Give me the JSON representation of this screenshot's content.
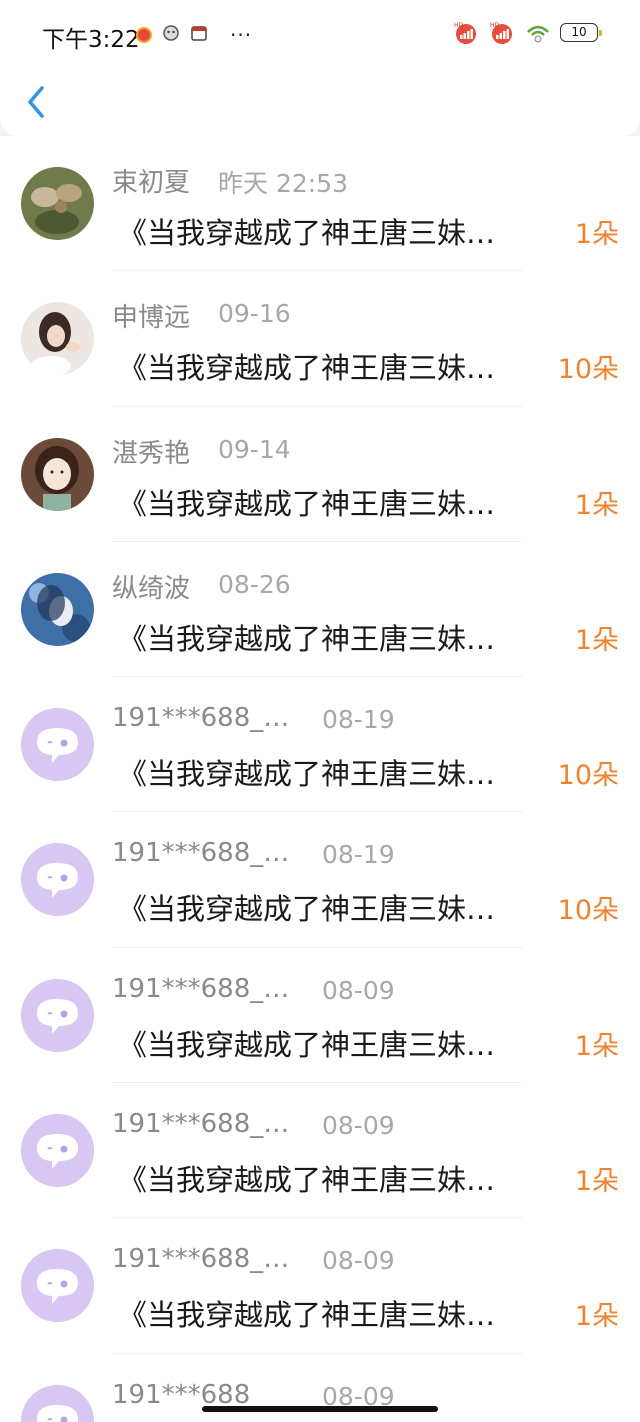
{
  "status": {
    "time": "下午3:22",
    "more": "···",
    "battery": "10"
  },
  "colors": {
    "accent": "#2f93e8",
    "gift": "#f0832d",
    "default_avatar": "#d8c7f2"
  },
  "back_icon": "chevron-left-icon",
  "records": [
    {
      "name": "束初夏",
      "date": "昨天 22:53",
      "title": "《当我穿越成了神王唐三妹…",
      "gift": "1朵",
      "avatar": "photo"
    },
    {
      "name": "申博远",
      "date": "09-16",
      "title": "《当我穿越成了神王唐三妹…",
      "gift": "10朵",
      "avatar": "photo"
    },
    {
      "name": "湛秀艳",
      "date": "09-14",
      "title": "《当我穿越成了神王唐三妹…",
      "gift": "1朵",
      "avatar": "photo"
    },
    {
      "name": "纵绮波",
      "date": "08-26",
      "title": "《当我穿越成了神王唐三妹…",
      "gift": "1朵",
      "avatar": "photo"
    },
    {
      "name": "191***688_…",
      "date": "08-19",
      "title": "《当我穿越成了神王唐三妹…",
      "gift": "10朵",
      "avatar": "default"
    },
    {
      "name": "191***688_…",
      "date": "08-19",
      "title": "《当我穿越成了神王唐三妹…",
      "gift": "10朵",
      "avatar": "default"
    },
    {
      "name": "191***688_…",
      "date": "08-09",
      "title": "《当我穿越成了神王唐三妹…",
      "gift": "1朵",
      "avatar": "default"
    },
    {
      "name": "191***688_…",
      "date": "08-09",
      "title": "《当我穿越成了神王唐三妹…",
      "gift": "1朵",
      "avatar": "default"
    },
    {
      "name": "191***688_…",
      "date": "08-09",
      "title": "《当我穿越成了神王唐三妹…",
      "gift": "1朵",
      "avatar": "default"
    },
    {
      "name": "191***688",
      "date": "08-09",
      "title": "",
      "gift": "",
      "avatar": "default"
    }
  ]
}
